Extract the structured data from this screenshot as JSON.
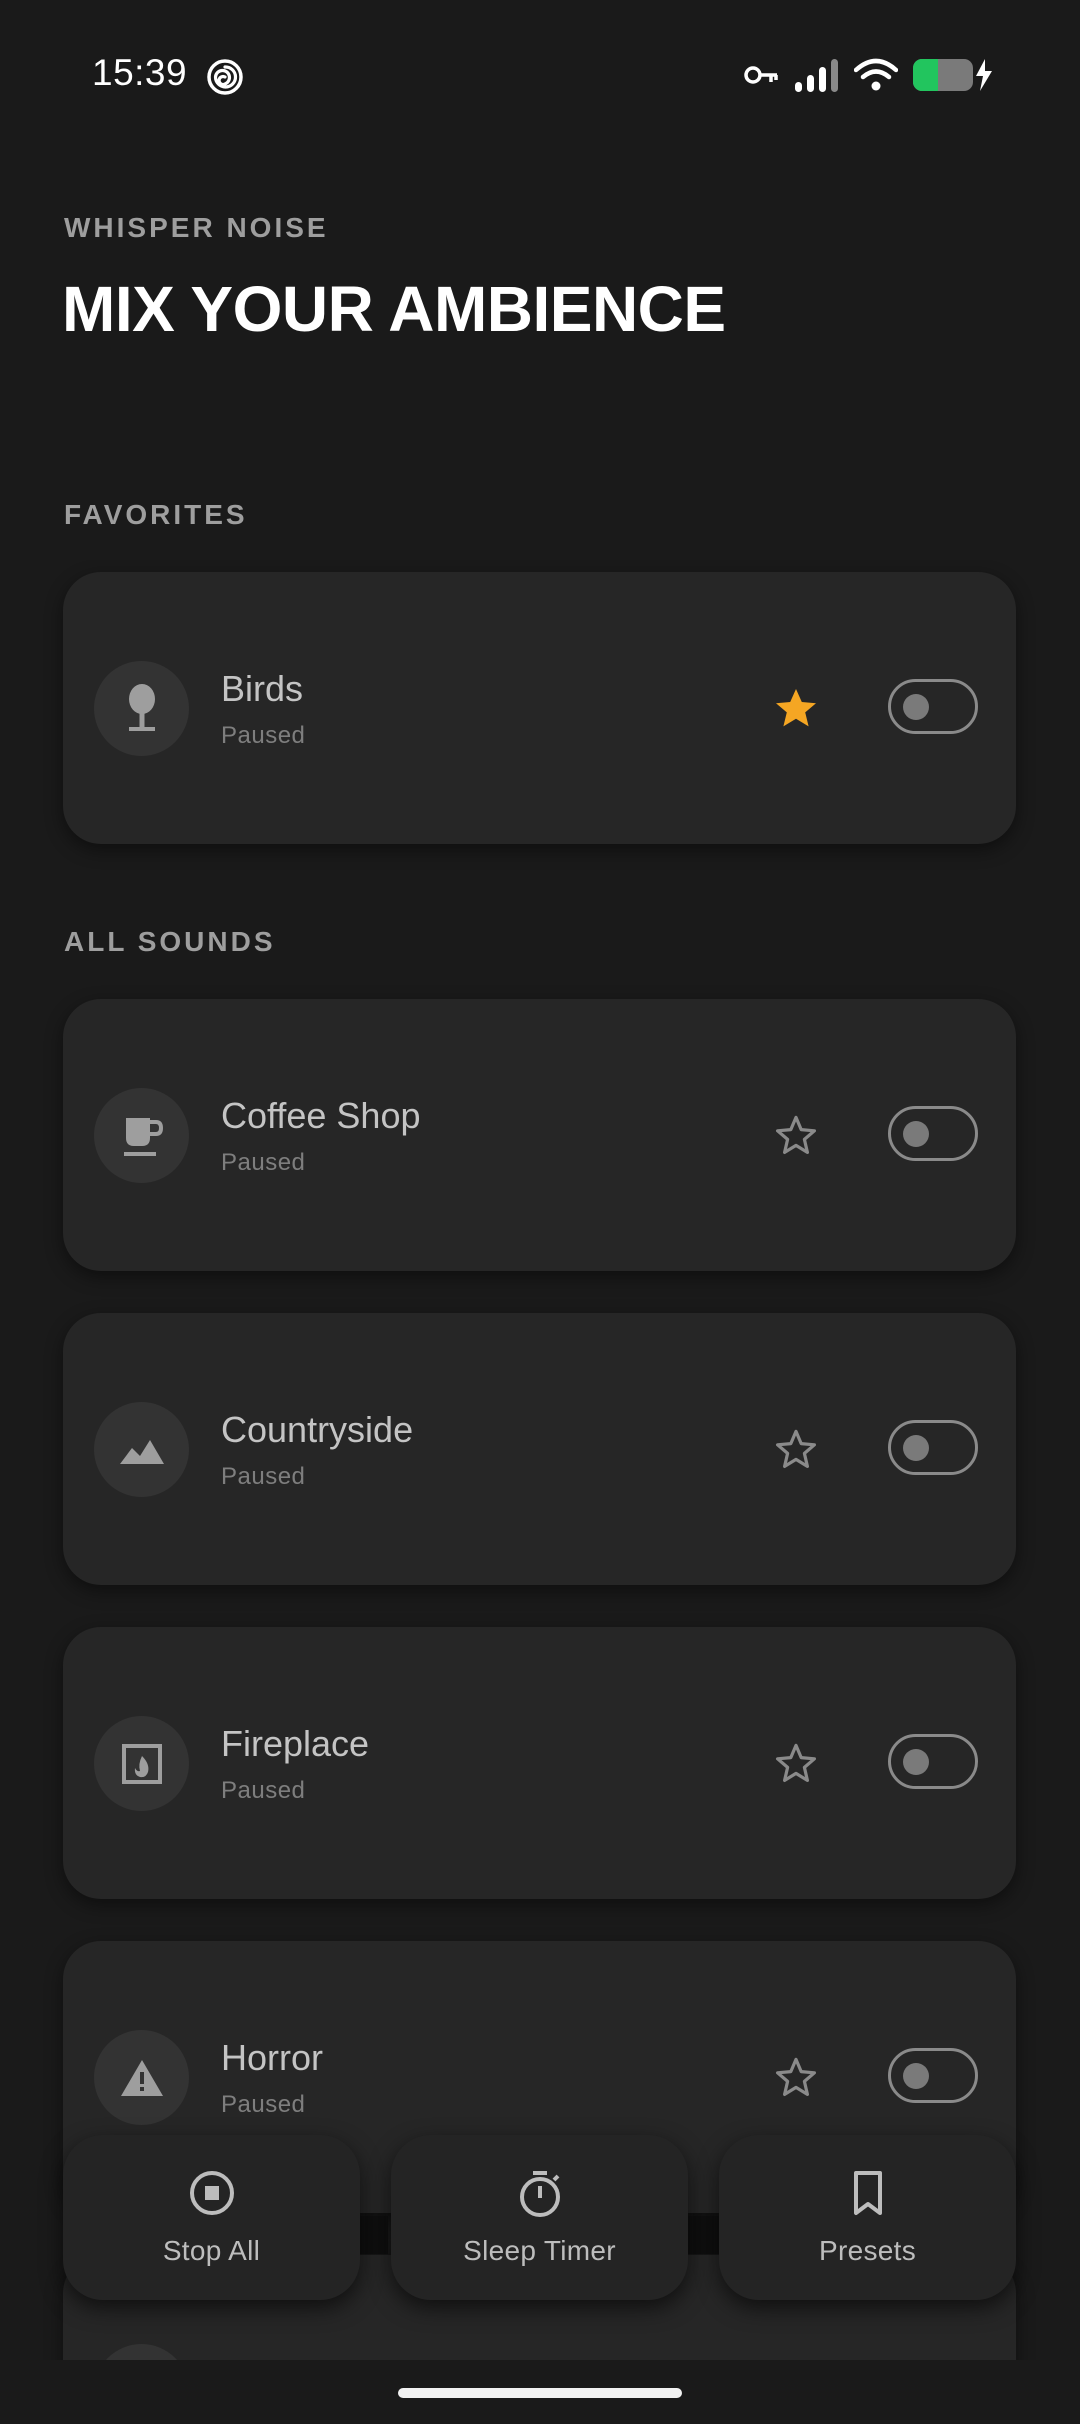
{
  "status_bar": {
    "time": "15:39",
    "icons": [
      "spiral-icon",
      "vpn-key-icon",
      "signal-icon",
      "wifi-icon",
      "battery-charging-icon"
    ],
    "battery_color": "#22c55e"
  },
  "header": {
    "app_label": "WHISPER NOISE",
    "title": "MIX YOUR AMBIENCE"
  },
  "sections": {
    "favorites": "FAVORITES",
    "all_sounds": "ALL SOUNDS"
  },
  "favorites": [
    {
      "name": "Birds",
      "status": "Paused",
      "icon": "tree-icon",
      "favorited": true,
      "on": false
    }
  ],
  "all_sounds": [
    {
      "name": "Coffee Shop",
      "status": "Paused",
      "icon": "coffee-cup-icon",
      "favorited": false,
      "on": false
    },
    {
      "name": "Countryside",
      "status": "Paused",
      "icon": "landscape-icon",
      "favorited": false,
      "on": false
    },
    {
      "name": "Fireplace",
      "status": "Paused",
      "icon": "fireplace-icon",
      "favorited": false,
      "on": false
    },
    {
      "name": "Horror",
      "status": "Paused",
      "icon": "warning-icon",
      "favorited": false,
      "on": false
    }
  ],
  "bottom_bar": {
    "stop_all": "Stop All",
    "sleep_timer": "Sleep Timer",
    "presets": "Presets"
  },
  "colors": {
    "background": "#1a1a1a",
    "card": "#262626",
    "accent_star": "#f5a623",
    "muted_text": "#9e9e9e"
  }
}
